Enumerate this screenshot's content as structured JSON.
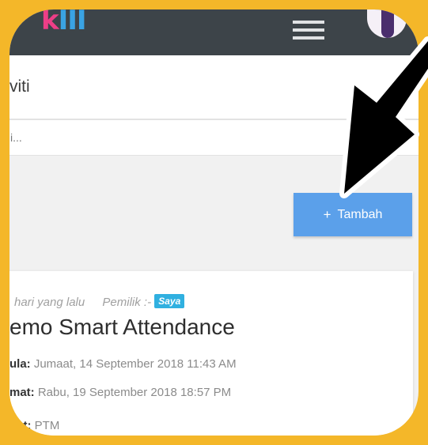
{
  "app": {
    "logo_part1": "k",
    "logo_part2": "III"
  },
  "page": {
    "title": "viti"
  },
  "search": {
    "text": "i..."
  },
  "actions": {
    "add_plus": "+",
    "add_label": "Tambah"
  },
  "event": {
    "time_ago": "hari yang lalu",
    "owner_label": "Pemilik :-",
    "owner_badge": "Saya",
    "title": "emo Smart Attendance",
    "start_key": "ula:",
    "start_value": "Jumaat, 14 September 2018 11:43 AM",
    "end_key": "mat:",
    "end_value": "Rabu, 19 September 2018 18:57 PM",
    "place_key": "pat:",
    "place_value": "PTM"
  },
  "colors": {
    "frame": "#f4b729",
    "topbar": "#3d4449",
    "button": "#5ba0ea",
    "badge": "#30b0e0"
  }
}
